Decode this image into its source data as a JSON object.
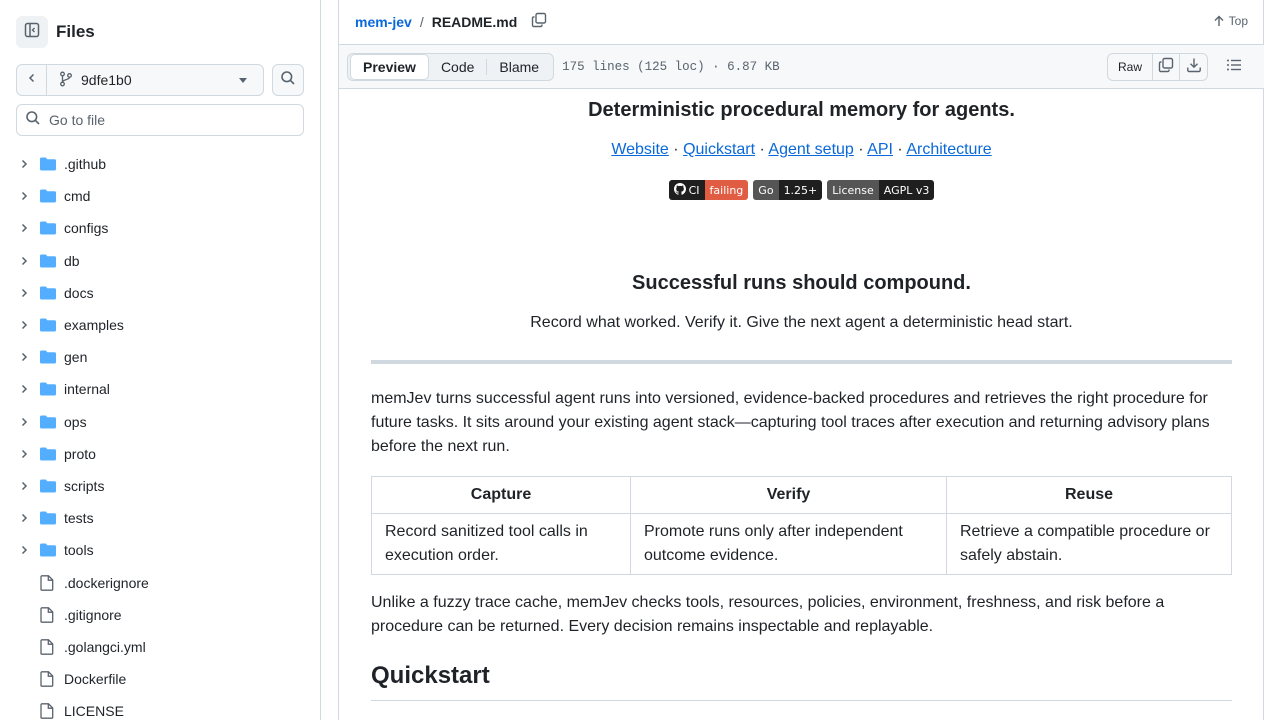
{
  "sidebar": {
    "title": "Files",
    "branch": "9dfe1b0",
    "goto_placeholder": "Go to file",
    "tree": [
      {
        "name": ".github",
        "type": "folder"
      },
      {
        "name": "cmd",
        "type": "folder"
      },
      {
        "name": "configs",
        "type": "folder"
      },
      {
        "name": "db",
        "type": "folder"
      },
      {
        "name": "docs",
        "type": "folder"
      },
      {
        "name": "examples",
        "type": "folder"
      },
      {
        "name": "gen",
        "type": "folder"
      },
      {
        "name": "internal",
        "type": "folder"
      },
      {
        "name": "ops",
        "type": "folder"
      },
      {
        "name": "proto",
        "type": "folder"
      },
      {
        "name": "scripts",
        "type": "folder"
      },
      {
        "name": "tests",
        "type": "folder"
      },
      {
        "name": "tools",
        "type": "folder"
      },
      {
        "name": ".dockerignore",
        "type": "file"
      },
      {
        "name": ".gitignore",
        "type": "file"
      },
      {
        "name": ".golangci.yml",
        "type": "file"
      },
      {
        "name": "Dockerfile",
        "type": "file"
      },
      {
        "name": "LICENSE",
        "type": "file"
      }
    ]
  },
  "header": {
    "repo": "mem-jev",
    "separator": "/",
    "file": "README.md",
    "top_label": "Top"
  },
  "toolbar": {
    "tabs": [
      "Preview",
      "Code",
      "Blame"
    ],
    "active_tab": "Preview",
    "file_meta": "175 lines (125 loc) · 6.87 KB",
    "raw_label": "Raw"
  },
  "readme": {
    "tagline": "Deterministic procedural memory for agents.",
    "links": [
      "Website",
      "Quickstart",
      "Agent setup",
      "API",
      "Architecture"
    ],
    "link_separator": "·",
    "badges": [
      {
        "label": "CI",
        "value": "failing",
        "color": "#e05d44"
      },
      {
        "label": "Go",
        "value": "1.25+",
        "color": "#1f1f1f"
      },
      {
        "label": "License",
        "value": "AGPL v3",
        "color": "#1f1f1f"
      }
    ],
    "heading": "Successful runs should compound.",
    "subheading": "Record what worked. Verify it. Give the next agent a deterministic head start.",
    "intro": "memJev turns successful agent runs into versioned, evidence-backed procedures and retrieves the right procedure for future tasks. It sits around your existing agent stack—capturing tool traces after execution and returning advisory plans before the next run.",
    "table": {
      "headers": [
        "Capture",
        "Verify",
        "Reuse"
      ],
      "rows": [
        [
          "Record sanitized tool calls in execution order.",
          "Promote runs only after independent outcome evidence.",
          "Retrieve a compatible procedure or safely abstain."
        ]
      ]
    },
    "outro": "Unlike a fuzzy trace cache, memJev checks tools, resources, policies, environment, freshness, and risk before a procedure can be returned. Every decision remains inspectable and replayable.",
    "quickstart_heading": "Quickstart"
  },
  "colors": {
    "link": "#0969da",
    "folder": "#54aeff",
    "border": "#d1d9e0"
  }
}
